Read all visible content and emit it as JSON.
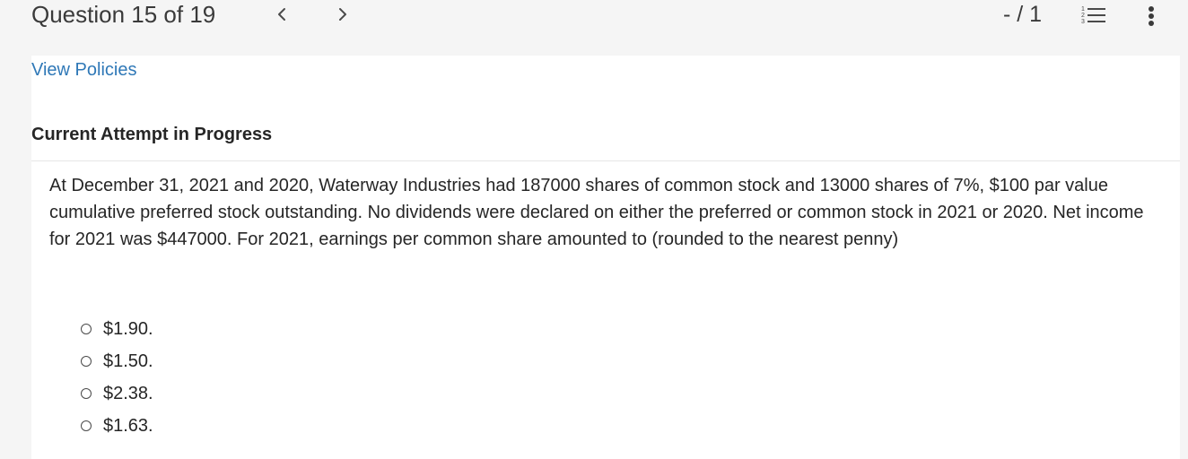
{
  "header": {
    "question_counter": "Question 15 of 19",
    "score": "- / 1",
    "icons": {
      "prev": "chevron-left-icon",
      "next": "chevron-right-icon",
      "list": "numbered-list-icon",
      "more": "vertical-ellipsis-icon"
    }
  },
  "links": {
    "view_policies": "View Policies"
  },
  "attempt": {
    "title": "Current Attempt in Progress"
  },
  "question": {
    "text": "At December 31, 2021 and 2020, Waterway Industries had 187000 shares of common stock and 13000 shares of 7%, $100 par value cumulative preferred stock outstanding. No dividends were declared on either the preferred or common stock in 2021 or 2020. Net income for 2021 was $447000. For 2021, earnings per common share amounted to (rounded to the nearest penny)",
    "options": [
      {
        "label": "$1.90."
      },
      {
        "label": "$1.50."
      },
      {
        "label": "$2.38."
      },
      {
        "label": "$1.63."
      }
    ]
  },
  "colors": {
    "link": "#2f78b7",
    "background": "#f5f5f5",
    "panel": "#ffffff"
  }
}
